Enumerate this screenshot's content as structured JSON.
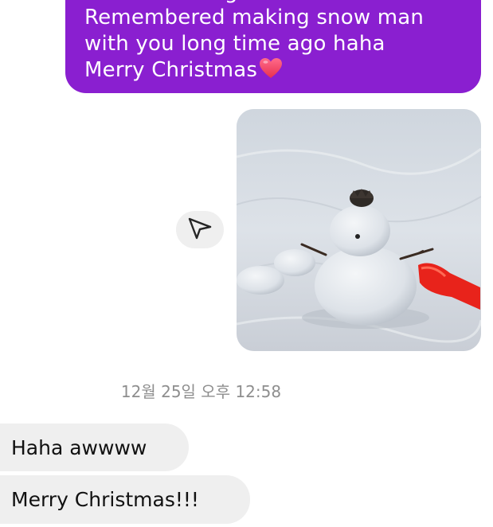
{
  "sent_message": {
    "lines": [
      "Remembered making snow man",
      "with you long time ago haha",
      "Merry Christmas"
    ],
    "emoji": "heart-icon",
    "bubble_color": "#8a1fd0"
  },
  "photo_message": {
    "subject": "snowman-photo"
  },
  "share_button": {
    "icon": "paper-plane-icon"
  },
  "timestamp": "12월 25일 오후 12:58",
  "received_messages": [
    "Haha awwww",
    "Merry Christmas!!!"
  ],
  "colors": {
    "sent_bubble": "#8a1fd0",
    "received_bubble": "#efefef",
    "timestamp_text": "#8e8e8e"
  }
}
